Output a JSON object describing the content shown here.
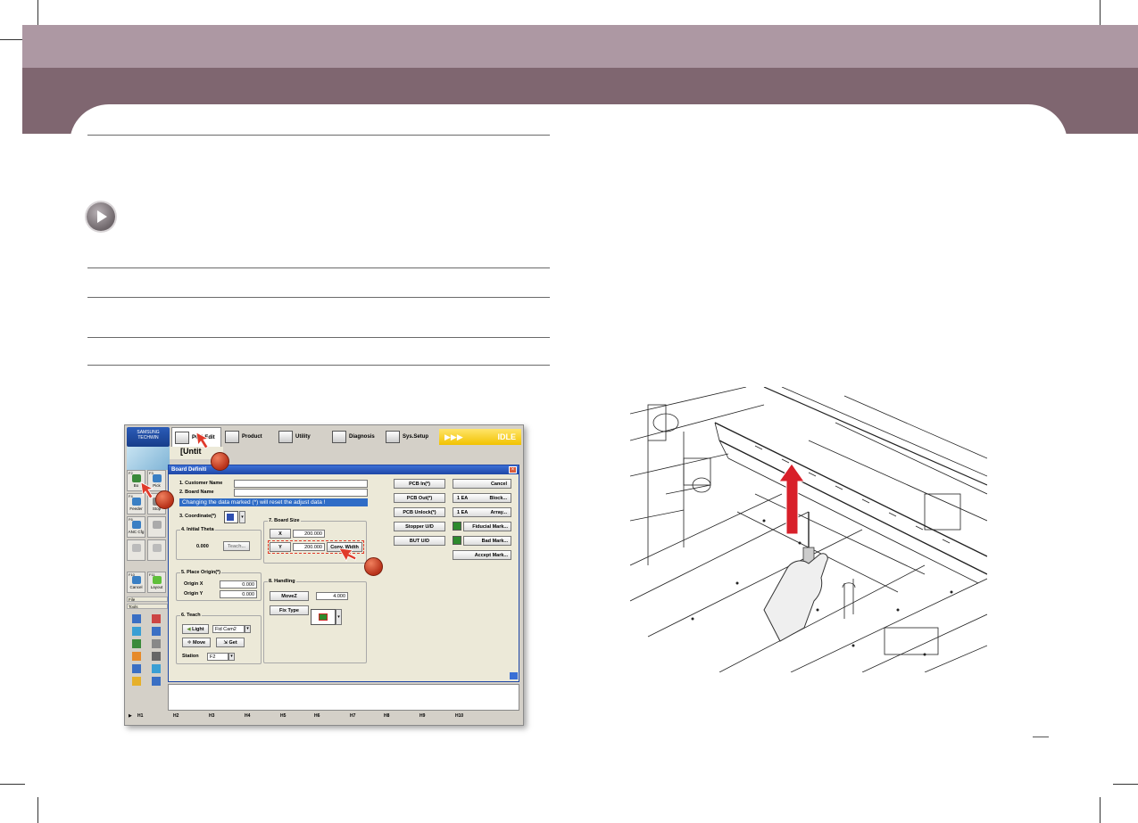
{
  "software": {
    "logo_text": "SAMSUNG\nTECHWIN",
    "top_menu": [
      {
        "label": "PCB Edit"
      },
      {
        "label": "Product"
      },
      {
        "label": "Utility"
      },
      {
        "label": "Diagnosis"
      },
      {
        "label": "Sys.Setup"
      }
    ],
    "status": "IDLE",
    "status_arrows": "▶▶▶",
    "doc_title": "[Untit",
    "dialog_title": "Board Definiti",
    "sidebar": [
      {
        "key": "F2",
        "label": "Bo"
      },
      {
        "key": "F3",
        "label": "Pick"
      },
      {
        "key": "F4",
        "label": "Feeder"
      },
      {
        "key": "",
        "label": "Stop"
      },
      {
        "key": "F6",
        "label": "ANC Cfg"
      },
      {
        "key": "F10",
        "label": "Cancel"
      },
      {
        "key": "F11",
        "label": "Layout"
      }
    ],
    "sidebar_sections": [
      "File",
      "Tools"
    ],
    "fields": {
      "customer_name_label": "1. Customer Name",
      "board_name_label": "2. Board Name",
      "warning": "Changing the data marked (*) will reset the adjust data !",
      "coordinate_label": "3. Coordinate(*)",
      "initial_theta_label": "4. Initial Theta",
      "initial_theta_value": "0.000",
      "teach_btn": "Teach...",
      "place_origin_label": "5. Place Origin(*)",
      "origin_x_label": "Origin X",
      "origin_x_value": "0.000",
      "origin_y_label": "Origin Y",
      "origin_y_value": "0.000",
      "teach_group_label": "6. Teach",
      "light_btn": "Light",
      "fid_select": "Fid Cam2",
      "move_btn": "Move",
      "get_btn": "Get",
      "station_label": "Station",
      "station_value": "F2",
      "board_size_label": "7. Board Size",
      "x_label": "X",
      "x_value": "200.000",
      "y_label": "Y",
      "y_value": "200.000",
      "conv_width_btn": "Conv. Width",
      "handling_label": "8. Handling",
      "movez_label": "MoveZ",
      "movez_value": "4.000",
      "fix_type_label": "Fix Type"
    },
    "right_buttons": {
      "pcb_in": "PCB In(*)",
      "pcb_out": "PCB Out(*)",
      "pcb_unlock": "PCB Unlock(*)",
      "stopper_ud": "Stopper U/D",
      "bút_ud": "BUT U/D",
      "cancel": "Cancel",
      "block_qty": "1 EA",
      "block": "Block...",
      "array_qty": "1 EA",
      "array": "Array...",
      "fiducial": "Fiducial Mark...",
      "bad": "Bad Mark...",
      "accept": "Accept Mark..."
    },
    "fkeys": [
      "H1",
      "H2",
      "H3",
      "H4",
      "H5",
      "H6",
      "H7",
      "H8",
      "H9",
      "H10"
    ]
  }
}
